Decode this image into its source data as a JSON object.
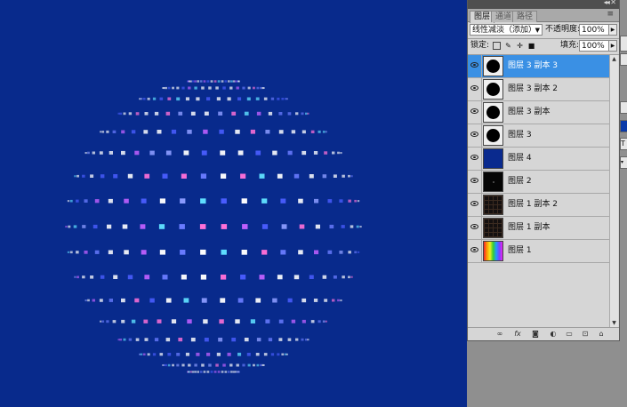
{
  "layers_panel": {
    "tabs": [
      {
        "label": "图层",
        "active": true
      },
      {
        "label": "通道",
        "active": false
      },
      {
        "label": "路径",
        "active": false
      }
    ],
    "blend_mode": "线性减淡（添加）",
    "opacity_label": "不透明度:",
    "opacity_value": "100%",
    "lock_label": "锁定:",
    "fill_label": "填充:",
    "fill_value": "100%",
    "layers": [
      {
        "name": "图层 3 副本 3",
        "thumbnail": "black-circle",
        "visible": true,
        "selected": true
      },
      {
        "name": "图层 3 副本 2",
        "thumbnail": "black-circle",
        "visible": true,
        "selected": false
      },
      {
        "name": "图层 3 副本",
        "thumbnail": "black-circle",
        "visible": true,
        "selected": false
      },
      {
        "name": "图层 3",
        "thumbnail": "black-circle",
        "visible": true,
        "selected": false
      },
      {
        "name": "图层 4",
        "thumbnail": "blue-fill",
        "visible": true,
        "selected": false
      },
      {
        "name": "图层 2",
        "thumbnail": "black-fill",
        "visible": true,
        "selected": false
      },
      {
        "name": "图层 1 副本 2",
        "thumbnail": "dark-grid",
        "visible": true,
        "selected": false
      },
      {
        "name": "图层 1 副本",
        "thumbnail": "dark-grid",
        "visible": true,
        "selected": false
      },
      {
        "name": "图层 1",
        "thumbnail": "rainbow",
        "visible": true,
        "selected": false
      }
    ],
    "footer_icons": [
      "link-layers-icon",
      "fx-icon",
      "layer-mask-icon",
      "adjustment-layer-icon",
      "new-group-icon",
      "new-layer-icon",
      "trash-icon"
    ]
  },
  "colors": {
    "canvas_background": "#082a8c",
    "selected_row": "#3a90e4",
    "panel": "#d6d6d6"
  }
}
